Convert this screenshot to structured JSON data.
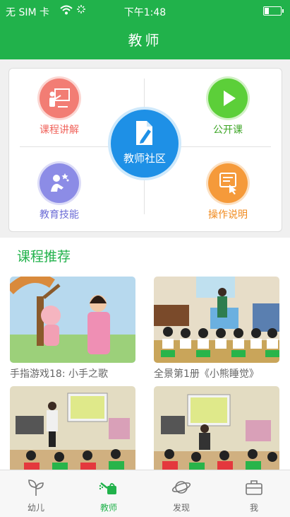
{
  "status": {
    "carrier": "无 SIM 卡",
    "time": "下午1:48"
  },
  "header": {
    "title": "教师"
  },
  "menu": {
    "top_left": "课程讲解",
    "top_right": "公开课",
    "center": "教师社区",
    "bottom_left": "教育技能",
    "bottom_right": "操作说明",
    "colors": {
      "top_left": "#f0625a",
      "top_right": "#3da626",
      "bottom_left": "#6b6bd6",
      "bottom_right": "#f08a1e",
      "center": "#1e90e6"
    }
  },
  "recommend": {
    "title": "课程推荐",
    "videos": [
      {
        "title": "手指游戏18: 小手之歌"
      },
      {
        "title": "全景第1册《小熊睡觉》"
      },
      {
        "title": ""
      },
      {
        "title": ""
      }
    ]
  },
  "tabs": [
    {
      "label": "幼儿",
      "icon": "sprout-icon"
    },
    {
      "label": "教师",
      "icon": "watering-can-icon",
      "active": true
    },
    {
      "label": "发现",
      "icon": "planet-icon"
    },
    {
      "label": "我",
      "icon": "briefcase-icon"
    }
  ],
  "theme": {
    "accent": "#21b24b"
  }
}
